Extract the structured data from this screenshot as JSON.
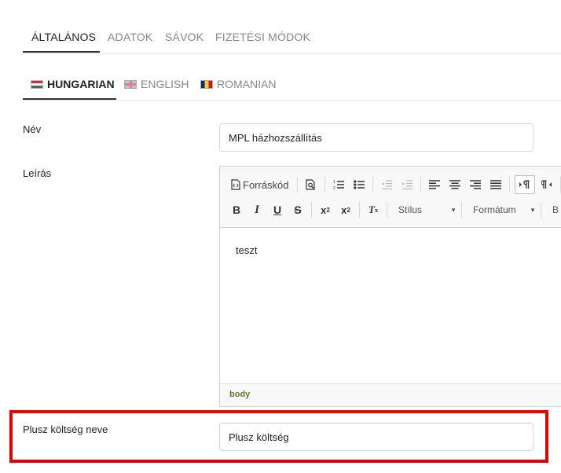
{
  "main_tabs": [
    {
      "label": "ÁLTALÁNOS",
      "active": true
    },
    {
      "label": "ADATOK",
      "active": false
    },
    {
      "label": "SÁVOK",
      "active": false
    },
    {
      "label": "FIZETÉSI MÓDOK",
      "active": false
    }
  ],
  "lang_tabs": [
    {
      "label": "HUNGARIAN",
      "flag": "hungary-flag-icon",
      "active": true
    },
    {
      "label": "ENGLISH",
      "flag": "uk-flag-icon",
      "active": false
    },
    {
      "label": "ROMANIAN",
      "flag": "romania-flag-icon",
      "active": false
    }
  ],
  "fields": {
    "name": {
      "label": "Név",
      "value": "MPL házhozszállítás"
    },
    "description": {
      "label": "Leírás"
    },
    "extra_cost_name": {
      "label": "Plusz költség neve",
      "value": "Plusz költség"
    }
  },
  "editor": {
    "toolbar": {
      "source_label": "Forráskód",
      "style_label": "Stílus",
      "format_label": "Formátum",
      "font_cut": "B"
    },
    "content": "teszt",
    "path": "body"
  },
  "colors": {
    "highlight": "#e80000",
    "active_tab_text": "#222222",
    "inactive_tab_text": "#888888",
    "path_text": "#5b7f2a"
  }
}
